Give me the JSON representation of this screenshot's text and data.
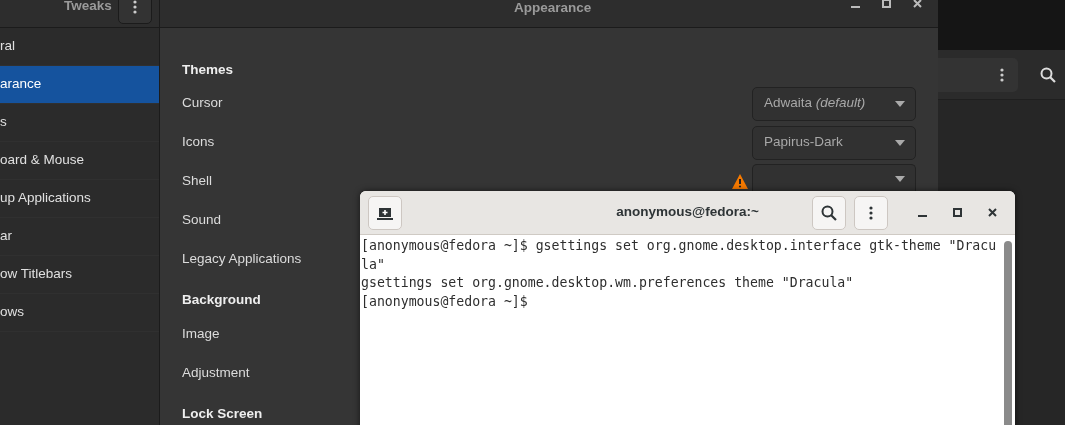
{
  "tweaks_window": {
    "app_title": "Tweaks",
    "title": "Appearance",
    "sidebar": {
      "items": [
        {
          "label": "ral",
          "selected": false
        },
        {
          "label": "arance",
          "selected": true
        },
        {
          "label": "s",
          "selected": false
        },
        {
          "label": "oard & Mouse",
          "selected": false
        },
        {
          "label": "up Applications",
          "selected": false
        },
        {
          "label": "ar",
          "selected": false
        },
        {
          "label": "ow Titlebars",
          "selected": false
        },
        {
          "label": "ows",
          "selected": false
        }
      ]
    },
    "sections": [
      {
        "heading": "Themes",
        "rows": [
          {
            "label": "Cursor",
            "kind": "dropdown",
            "value": "Adwaita *(default)*"
          },
          {
            "label": "Icons",
            "kind": "dropdown",
            "value": "Papirus-Dark"
          },
          {
            "label": "Shell",
            "kind": "dropdown",
            "warning": true
          },
          {
            "label": "Sound",
            "kind": "label"
          },
          {
            "label": "Legacy Applications",
            "kind": "label"
          }
        ]
      },
      {
        "heading": "Background",
        "rows": [
          {
            "label": "Image",
            "kind": "label"
          },
          {
            "label": "Adjustment",
            "kind": "label"
          }
        ]
      },
      {
        "heading": "Lock Screen"
      }
    ]
  },
  "terminal_window": {
    "title": "anonymous@fedora:~",
    "lines": [
      "[anonymous@fedora ~]$ gsettings set org.gnome.desktop.interface gtk-theme \"Dracu",
      "la\"",
      "gsettings set org.gnome.desktop.wm.preferences theme \"Dracula\"",
      "[anonymous@fedora ~]$"
    ]
  }
}
